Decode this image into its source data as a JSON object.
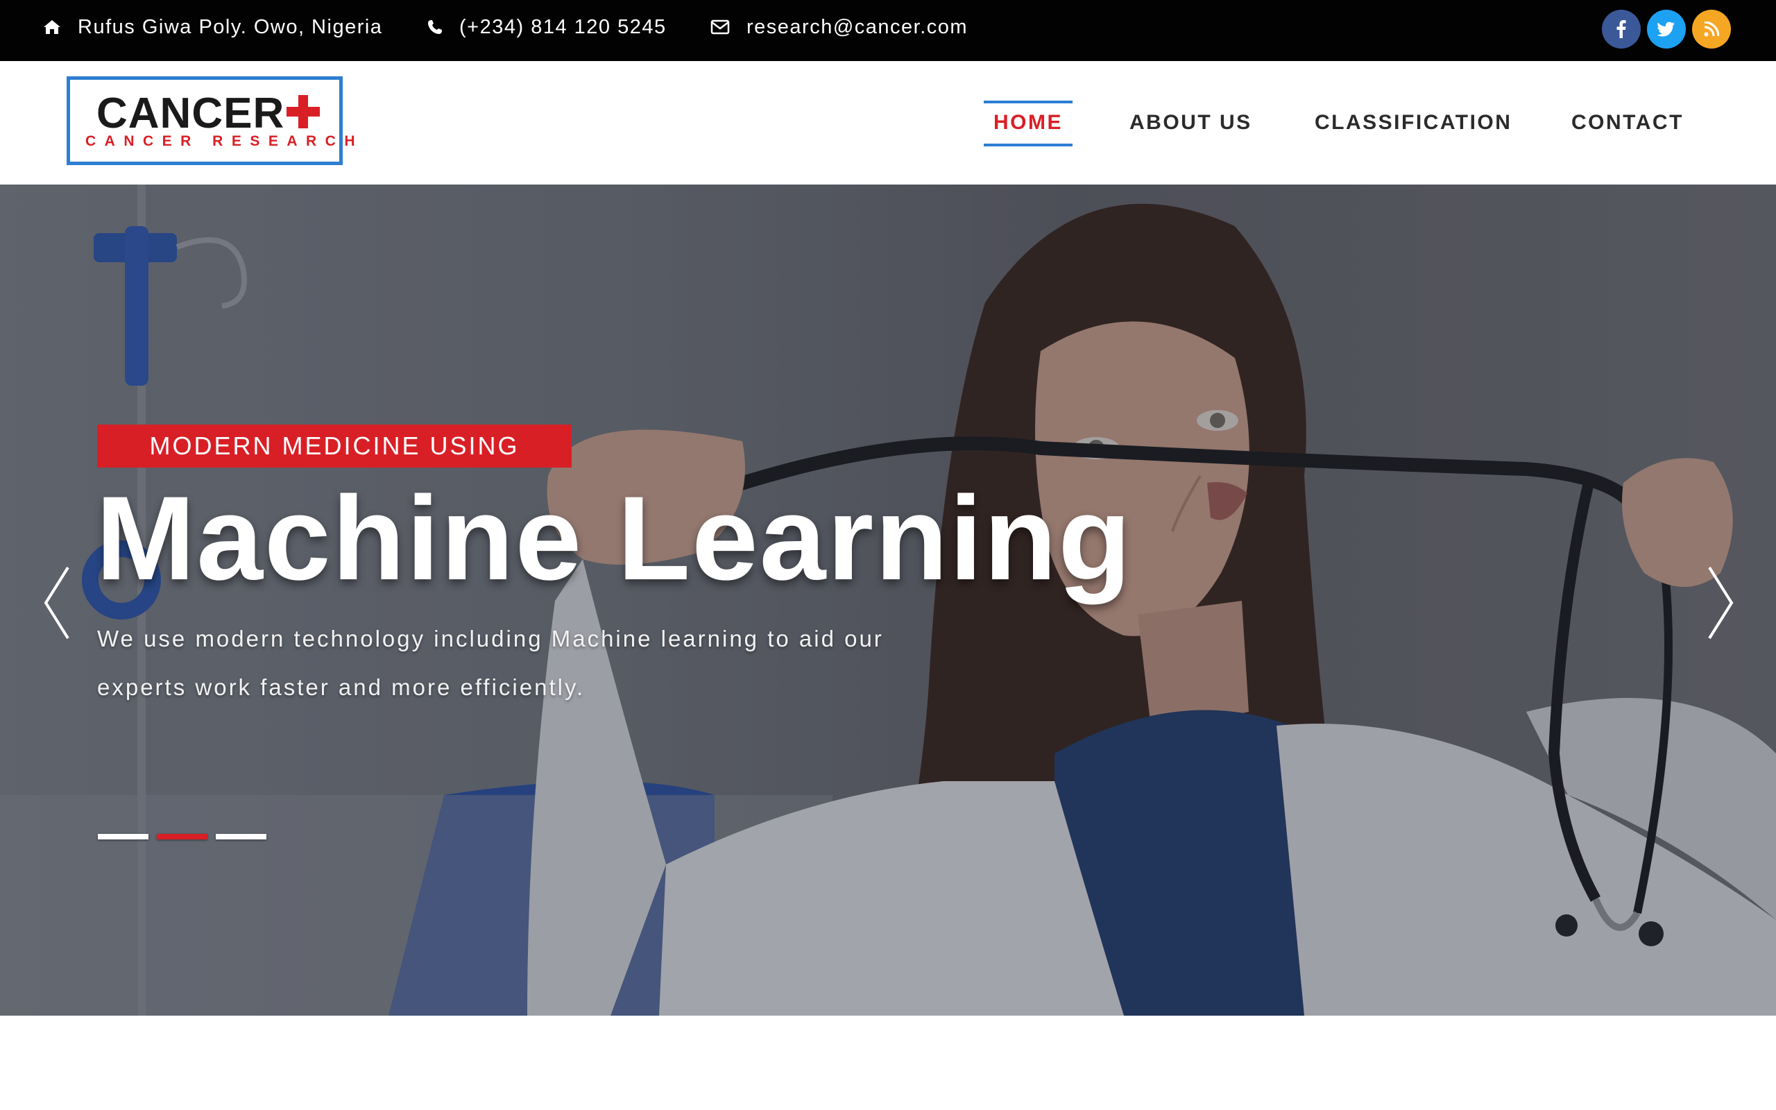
{
  "topbar": {
    "address": "Rufus Giwa Poly. Owo, Nigeria",
    "phone": "(+234) 814 120 5245",
    "email": "research@cancer.com",
    "icons": {
      "address": "home-icon",
      "phone": "phone-icon",
      "email": "envelope-icon"
    },
    "social": [
      {
        "name": "facebook-icon",
        "color": "#3b5998"
      },
      {
        "name": "twitter-icon",
        "color": "#1da1f2"
      },
      {
        "name": "rss-icon",
        "color": "#f5a623"
      }
    ]
  },
  "logo": {
    "title": "CANCER",
    "subtitle": "CANCER RESEARCH",
    "border_color": "#2d7ed3",
    "accent_color": "#d91f26"
  },
  "nav": {
    "items": [
      {
        "label": "HOME",
        "active": true
      },
      {
        "label": "ABOUT US",
        "active": false
      },
      {
        "label": "CLASSIFICATION",
        "active": false
      },
      {
        "label": "CONTACT",
        "active": false
      }
    ],
    "active_color": "#d91f26",
    "active_underline_color": "#2d7ed3"
  },
  "hero": {
    "badge": "MODERN MEDICINE USING",
    "headline": "Machine Learning",
    "description": "We use modern technology including Machine learning to aid our experts work faster and more efficiently.",
    "prev_icon": "chevron-left-icon",
    "next_icon": "chevron-right-icon",
    "slides_total": 3,
    "active_slide": 2
  }
}
